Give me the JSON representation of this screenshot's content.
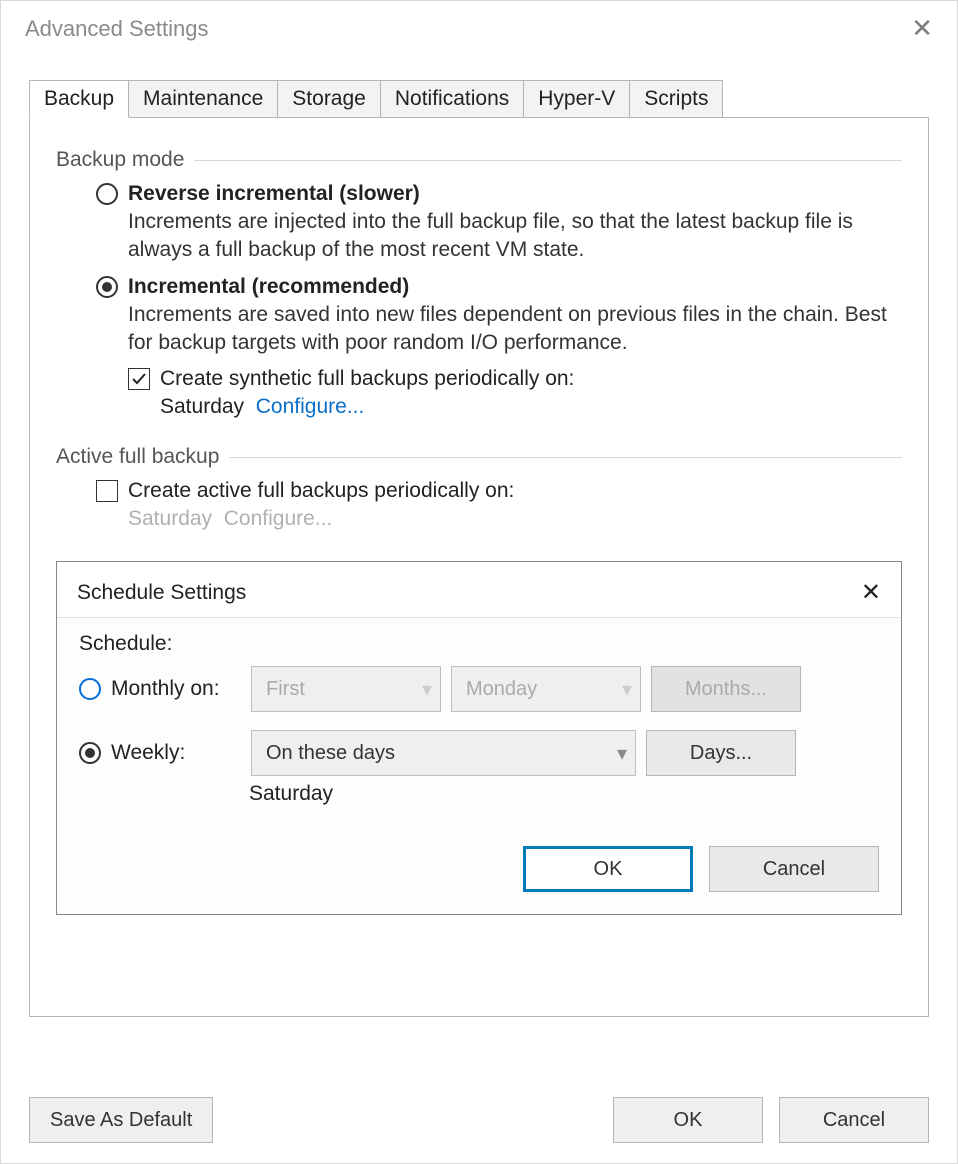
{
  "title": "Advanced Settings",
  "tabs": [
    "Backup",
    "Maintenance",
    "Storage",
    "Notifications",
    "Hyper-V",
    "Scripts"
  ],
  "active_tab_index": 0,
  "backup_mode": {
    "group_label": "Backup mode",
    "reverse": {
      "title": "Reverse incremental (slower)",
      "desc": "Increments are injected into the full backup file, so that the latest backup file is always a full backup of the most recent VM state."
    },
    "incremental": {
      "title": "Incremental (recommended)",
      "desc": "Increments are saved into new files dependent on previous files in the chain. Best for backup targets with poor random I/O performance.",
      "synthetic_label": "Create synthetic full backups periodically on:",
      "synthetic_day": "Saturday",
      "configure_label": "Configure..."
    }
  },
  "active_full": {
    "group_label": "Active full backup",
    "check_label": "Create active full backups periodically on:",
    "day": "Saturday",
    "configure_label": "Configure..."
  },
  "schedule_dialog": {
    "title": "Schedule Settings",
    "schedule_label": "Schedule:",
    "monthly_label": "Monthly on:",
    "monthly_ordinal": "First",
    "monthly_day": "Monday",
    "months_button": "Months...",
    "weekly_label": "Weekly:",
    "weekly_combo": "On these days",
    "days_button": "Days...",
    "weekly_day_summary": "Saturday",
    "ok": "OK",
    "cancel": "Cancel"
  },
  "buttons": {
    "save_default": "Save As Default",
    "ok": "OK",
    "cancel": "Cancel"
  }
}
